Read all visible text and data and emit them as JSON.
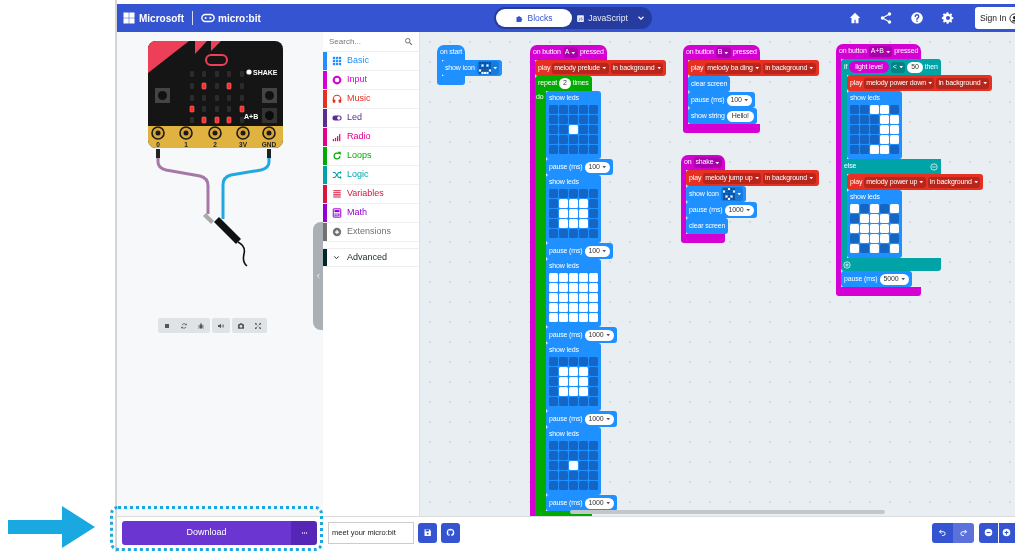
{
  "header": {
    "brand": "Microsoft",
    "product": "micro:bit",
    "tabs": [
      {
        "label": "Blocks",
        "selected": true
      },
      {
        "label": "JavaScript",
        "selected": false
      }
    ],
    "sign_in": "Sign In"
  },
  "simulator": {
    "leds": [
      [
        false,
        false,
        false,
        false,
        false
      ],
      [
        false,
        true,
        false,
        true,
        false
      ],
      [
        false,
        false,
        false,
        false,
        false
      ],
      [
        true,
        false,
        false,
        false,
        true
      ],
      [
        false,
        true,
        true,
        true,
        false
      ]
    ],
    "shake_label": "SHAKE",
    "ab_label": "A+B",
    "pins": [
      "0",
      "1",
      "2",
      "3V",
      "GND"
    ]
  },
  "toolbox": {
    "search": {
      "placeholder": "Search..."
    },
    "categories": [
      {
        "label": "Basic",
        "color": "#1e90ff",
        "kind": "category"
      },
      {
        "label": "Input",
        "color": "#d400d4",
        "kind": "category"
      },
      {
        "label": "Music",
        "color": "#e63022",
        "kind": "category"
      },
      {
        "label": "Led",
        "color": "#5c2d91",
        "kind": "category"
      },
      {
        "label": "Radio",
        "color": "#e3008c",
        "kind": "category"
      },
      {
        "label": "Loops",
        "color": "#00aa00",
        "kind": "category"
      },
      {
        "label": "Logic",
        "color": "#00a4a6",
        "kind": "category"
      },
      {
        "label": "Variables",
        "color": "#dc143c",
        "kind": "category"
      },
      {
        "label": "Math",
        "color": "#9400d3",
        "kind": "category"
      },
      {
        "label": "Extensions",
        "color": "#717171",
        "kind": "category"
      },
      {
        "label": "Advanced",
        "color": "#00272b",
        "kind": "advanced"
      }
    ]
  },
  "workspace": {
    "stacks": [
      {
        "kind": "event",
        "color": "#1e90ff",
        "parts": [
          {
            "kind": "label",
            "text": "on start"
          }
        ],
        "body": [
          {
            "kind": "statement",
            "color": "#1e90ff",
            "parts": [
              {
                "kind": "label",
                "text": "show icon"
              },
              {
                "kind": "icon",
                "leds": [
                  [
                    false,
                    false,
                    false,
                    false,
                    false
                  ],
                  [
                    false,
                    true,
                    false,
                    true,
                    false
                  ],
                  [
                    false,
                    false,
                    false,
                    false,
                    false
                  ],
                  [
                    true,
                    false,
                    false,
                    false,
                    true
                  ],
                  [
                    false,
                    true,
                    true,
                    true,
                    false
                  ]
                ]
              }
            ]
          }
        ]
      },
      {
        "kind": "event",
        "color": "#d400d4",
        "parts": [
          {
            "kind": "label",
            "text": "on button"
          },
          {
            "kind": "dropdown",
            "text": "A"
          },
          {
            "kind": "label",
            "text": "pressed"
          }
        ],
        "body": [
          {
            "kind": "statement",
            "color": "#e63022",
            "parts": [
              {
                "kind": "label",
                "text": "play"
              },
              {
                "kind": "dropdown",
                "text": "melody prelude"
              },
              {
                "kind": "dropdown",
                "text": "in background"
              }
            ]
          },
          {
            "kind": "loop",
            "color": "#00aa00",
            "parts": [
              {
                "kind": "label",
                "text": "repeat"
              },
              {
                "kind": "number",
                "text": "2"
              },
              {
                "kind": "label",
                "text": "times"
              }
            ],
            "do_label": "do",
            "body": [
              {
                "kind": "leds",
                "color": "#1e90ff",
                "parts": [
                  {
                    "kind": "label",
                    "text": "show leds"
                  }
                ],
                "leds": [
                  [
                    false,
                    false,
                    false,
                    false,
                    false
                  ],
                  [
                    false,
                    false,
                    false,
                    false,
                    false
                  ],
                  [
                    false,
                    false,
                    true,
                    false,
                    false
                  ],
                  [
                    false,
                    false,
                    false,
                    false,
                    false
                  ],
                  [
                    false,
                    false,
                    false,
                    false,
                    false
                  ]
                ]
              },
              {
                "kind": "statement",
                "color": "#1e90ff",
                "parts": [
                  {
                    "kind": "label",
                    "text": "pause (ms)"
                  },
                  {
                    "kind": "number_menu",
                    "text": "100"
                  }
                ]
              },
              {
                "kind": "leds",
                "color": "#1e90ff",
                "parts": [
                  {
                    "kind": "label",
                    "text": "show leds"
                  }
                ],
                "leds": [
                  [
                    false,
                    false,
                    false,
                    false,
                    false
                  ],
                  [
                    false,
                    true,
                    true,
                    true,
                    false
                  ],
                  [
                    false,
                    true,
                    true,
                    true,
                    false
                  ],
                  [
                    false,
                    true,
                    true,
                    true,
                    false
                  ],
                  [
                    false,
                    false,
                    false,
                    false,
                    false
                  ]
                ]
              },
              {
                "kind": "statement",
                "color": "#1e90ff",
                "parts": [
                  {
                    "kind": "label",
                    "text": "pause (ms)"
                  },
                  {
                    "kind": "number_menu",
                    "text": "100"
                  }
                ]
              },
              {
                "kind": "leds",
                "color": "#1e90ff",
                "parts": [
                  {
                    "kind": "label",
                    "text": "show leds"
                  }
                ],
                "leds": [
                  [
                    true,
                    true,
                    true,
                    true,
                    true
                  ],
                  [
                    true,
                    true,
                    true,
                    true,
                    true
                  ],
                  [
                    true,
                    true,
                    true,
                    true,
                    true
                  ],
                  [
                    true,
                    true,
                    true,
                    true,
                    true
                  ],
                  [
                    true,
                    true,
                    true,
                    true,
                    true
                  ]
                ]
              },
              {
                "kind": "statement",
                "color": "#1e90ff",
                "parts": [
                  {
                    "kind": "label",
                    "text": "pause (ms)"
                  },
                  {
                    "kind": "number_menu",
                    "text": "1000"
                  }
                ]
              },
              {
                "kind": "leds",
                "color": "#1e90ff",
                "parts": [
                  {
                    "kind": "label",
                    "text": "show leds"
                  }
                ],
                "leds": [
                  [
                    false,
                    false,
                    false,
                    false,
                    false
                  ],
                  [
                    false,
                    true,
                    true,
                    true,
                    false
                  ],
                  [
                    false,
                    true,
                    true,
                    true,
                    false
                  ],
                  [
                    false,
                    true,
                    true,
                    true,
                    false
                  ],
                  [
                    false,
                    false,
                    false,
                    false,
                    false
                  ]
                ]
              },
              {
                "kind": "statement",
                "color": "#1e90ff",
                "parts": [
                  {
                    "kind": "label",
                    "text": "pause (ms)"
                  },
                  {
                    "kind": "number_menu",
                    "text": "1000"
                  }
                ]
              },
              {
                "kind": "leds",
                "color": "#1e90ff",
                "parts": [
                  {
                    "kind": "label",
                    "text": "show leds"
                  }
                ],
                "leds": [
                  [
                    false,
                    false,
                    false,
                    false,
                    false
                  ],
                  [
                    false,
                    false,
                    false,
                    false,
                    false
                  ],
                  [
                    false,
                    false,
                    true,
                    false,
                    false
                  ],
                  [
                    false,
                    false,
                    false,
                    false,
                    false
                  ],
                  [
                    false,
                    false,
                    false,
                    false,
                    false
                  ]
                ]
              },
              {
                "kind": "statement",
                "color": "#1e90ff",
                "parts": [
                  {
                    "kind": "label",
                    "text": "pause (ms)"
                  },
                  {
                    "kind": "number_menu",
                    "text": "1000"
                  }
                ]
              }
            ]
          }
        ]
      },
      {
        "kind": "event",
        "color": "#d400d4",
        "parts": [
          {
            "kind": "label",
            "text": "on button"
          },
          {
            "kind": "dropdown",
            "text": "B"
          },
          {
            "kind": "label",
            "text": "pressed"
          }
        ],
        "body": [
          {
            "kind": "statement",
            "color": "#e63022",
            "parts": [
              {
                "kind": "label",
                "text": "play"
              },
              {
                "kind": "dropdown",
                "text": "melody ba ding"
              },
              {
                "kind": "dropdown",
                "text": "in background"
              }
            ]
          },
          {
            "kind": "statement",
            "color": "#1e90ff",
            "parts": [
              {
                "kind": "label",
                "text": "clear screen"
              }
            ]
          },
          {
            "kind": "statement",
            "color": "#1e90ff",
            "parts": [
              {
                "kind": "label",
                "text": "pause (ms)"
              },
              {
                "kind": "number_menu",
                "text": "100"
              }
            ]
          },
          {
            "kind": "statement",
            "color": "#1e90ff",
            "parts": [
              {
                "kind": "label",
                "text": "show string"
              },
              {
                "kind": "string",
                "text": "Hello!"
              }
            ]
          }
        ]
      },
      {
        "kind": "event",
        "color": "#d400d4",
        "parts": [
          {
            "kind": "label",
            "text": "on"
          },
          {
            "kind": "dropdown",
            "text": "shake"
          }
        ],
        "body": [
          {
            "kind": "statement",
            "color": "#e63022",
            "parts": [
              {
                "kind": "label",
                "text": "play"
              },
              {
                "kind": "dropdown",
                "text": "melody jump up"
              },
              {
                "kind": "dropdown",
                "text": "in background"
              }
            ]
          },
          {
            "kind": "statement",
            "color": "#1e90ff",
            "parts": [
              {
                "kind": "label",
                "text": "show icon"
              },
              {
                "kind": "icon",
                "leds": [
                  [
                    false,
                    false,
                    true,
                    false,
                    false
                  ],
                  [
                    true,
                    false,
                    false,
                    false,
                    true
                  ],
                  [
                    false,
                    false,
                    false,
                    false,
                    false
                  ],
                  [
                    false,
                    true,
                    false,
                    true,
                    false
                  ],
                  [
                    false,
                    false,
                    true,
                    false,
                    false
                  ]
                ]
              }
            ]
          },
          {
            "kind": "statement",
            "color": "#1e90ff",
            "parts": [
              {
                "kind": "label",
                "text": "pause (ms)"
              },
              {
                "kind": "number_menu",
                "text": "1000"
              }
            ]
          },
          {
            "kind": "statement",
            "color": "#1e90ff",
            "parts": [
              {
                "kind": "label",
                "text": "clear screen"
              }
            ]
          }
        ]
      },
      {
        "kind": "event",
        "color": "#d400d4",
        "parts": [
          {
            "kind": "label",
            "text": "on button"
          },
          {
            "kind": "dropdown",
            "text": "A+B"
          },
          {
            "kind": "label",
            "text": "pressed"
          }
        ],
        "body": [
          {
            "kind": "if_else",
            "color": "#00a4a6",
            "parts": [
              {
                "kind": "label",
                "text": "if"
              },
              {
                "kind": "reporter",
                "text": "light level",
                "color": "#d400d4"
              },
              {
                "kind": "dropdown",
                "text": "<"
              },
              {
                "kind": "number",
                "text": "50"
              },
              {
                "kind": "label",
                "text": "then"
              }
            ],
            "body": [
              {
                "kind": "statement",
                "color": "#e63022",
                "parts": [
                  {
                    "kind": "label",
                    "text": "play"
                  },
                  {
                    "kind": "dropdown",
                    "text": "melody power down"
                  },
                  {
                    "kind": "dropdown",
                    "text": "in background"
                  }
                ]
              },
              {
                "kind": "leds",
                "color": "#1e90ff",
                "parts": [
                  {
                    "kind": "label",
                    "text": "show leds"
                  }
                ],
                "leds": [
                  [
                    false,
                    false,
                    true,
                    true,
                    false
                  ],
                  [
                    false,
                    false,
                    false,
                    true,
                    true
                  ],
                  [
                    false,
                    false,
                    false,
                    true,
                    true
                  ],
                  [
                    false,
                    false,
                    false,
                    true,
                    true
                  ],
                  [
                    false,
                    false,
                    true,
                    true,
                    false
                  ]
                ]
              }
            ],
            "else_label": "else",
            "else_body": [
              {
                "kind": "statement",
                "color": "#e63022",
                "parts": [
                  {
                    "kind": "label",
                    "text": "play"
                  },
                  {
                    "kind": "dropdown",
                    "text": "melody power up"
                  },
                  {
                    "kind": "dropdown",
                    "text": "in background"
                  }
                ]
              },
              {
                "kind": "leds",
                "color": "#1e90ff",
                "parts": [
                  {
                    "kind": "label",
                    "text": "show leds"
                  }
                ],
                "leds": [
                  [
                    true,
                    false,
                    true,
                    false,
                    true
                  ],
                  [
                    false,
                    true,
                    true,
                    true,
                    false
                  ],
                  [
                    true,
                    true,
                    true,
                    true,
                    true
                  ],
                  [
                    false,
                    true,
                    true,
                    true,
                    false
                  ],
                  [
                    true,
                    false,
                    true,
                    false,
                    true
                  ]
                ]
              }
            ]
          },
          {
            "kind": "statement",
            "color": "#1e90ff",
            "parts": [
              {
                "kind": "label",
                "text": "pause (ms)"
              },
              {
                "kind": "number_menu",
                "text": "5000"
              }
            ]
          }
        ]
      }
    ]
  },
  "bottom_bar": {
    "download": "Download",
    "project_name": "meet your micro:bit"
  }
}
